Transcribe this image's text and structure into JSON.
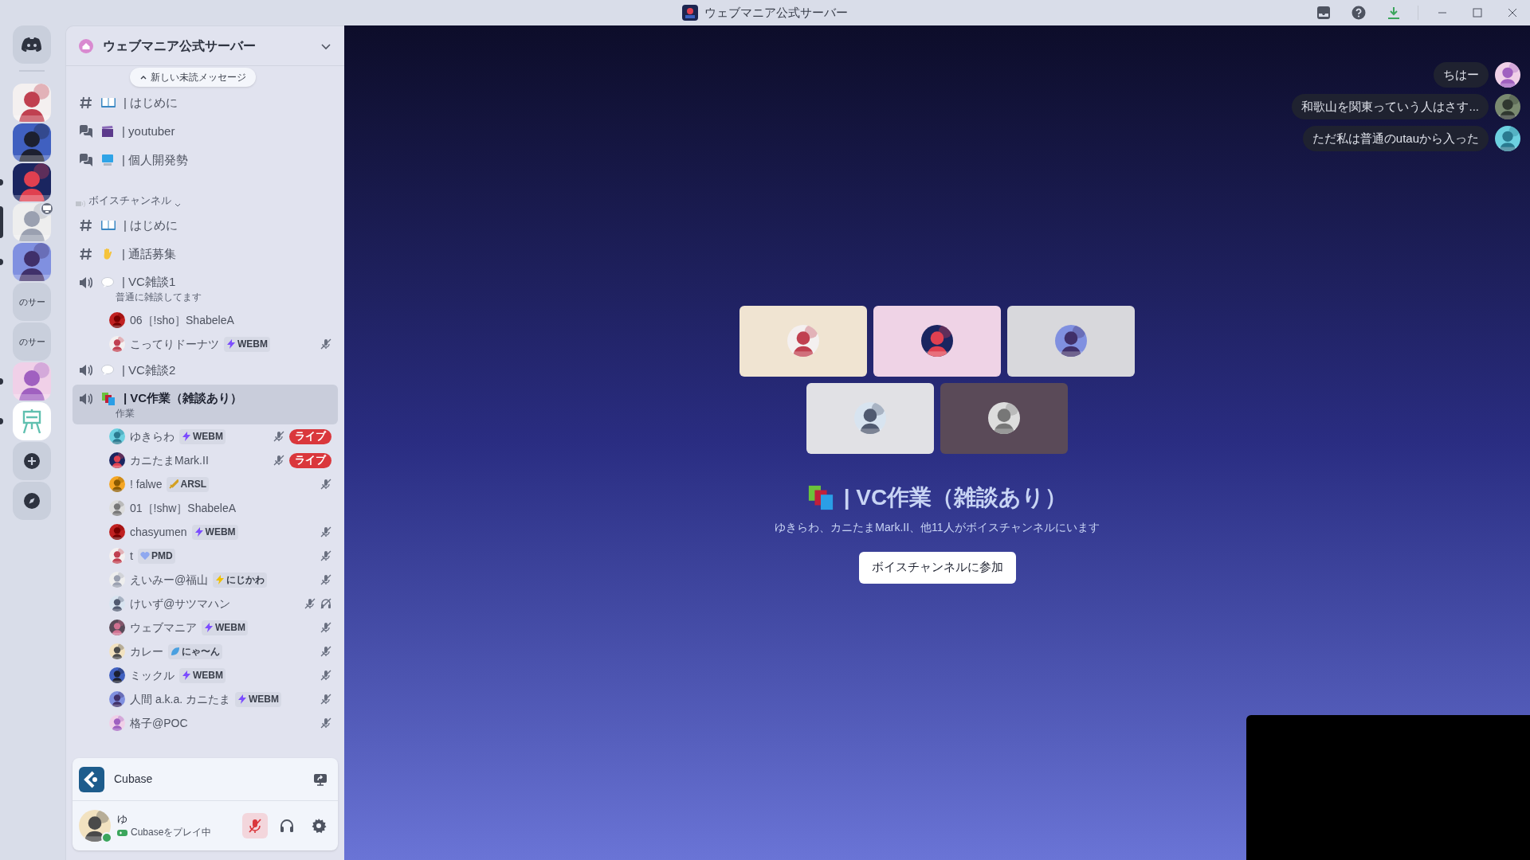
{
  "window": {
    "title": "ウェブマニア公式サーバー"
  },
  "servers": [
    {
      "kind": "home",
      "selected": false,
      "unread": false
    },
    {
      "kind": "picture",
      "selected": false,
      "unread": false
    },
    {
      "kind": "picture",
      "selected": false,
      "unread": false
    },
    {
      "kind": "picture",
      "selected": false,
      "unread": true
    },
    {
      "kind": "picture",
      "selected": true,
      "unread": false,
      "streaming": true
    },
    {
      "kind": "picture",
      "selected": false,
      "unread": true
    },
    {
      "kind": "label",
      "label": "のサー",
      "selected": false,
      "unread": false
    },
    {
      "kind": "label",
      "label": "のサー",
      "selected": false,
      "unread": false
    },
    {
      "kind": "picture",
      "selected": false,
      "unread": true
    },
    {
      "kind": "easel",
      "selected": false,
      "unread": true
    },
    {
      "kind": "add",
      "selected": false,
      "unread": false
    },
    {
      "kind": "explore",
      "selected": false,
      "unread": false
    }
  ],
  "sidebar": {
    "server_name": "ウェブマニア公式サーバー",
    "new_messages": "新しい未読メッセージ",
    "items": [
      {
        "kind": "text",
        "emoji": {
          "kind": "book"
        },
        "name": "| はじめに",
        "selected": false
      },
      {
        "kind": "forum",
        "emoji": {
          "kind": "clapper"
        },
        "name": "| youtuber",
        "selected": false
      },
      {
        "kind": "forum",
        "emoji": {
          "kind": "monitor"
        },
        "name": "| 個人開発勢",
        "selected": false
      },
      {
        "kind": "category",
        "name": "ボイスチャンネル"
      },
      {
        "kind": "text",
        "emoji": {
          "kind": "book"
        },
        "name": "| はじめに",
        "selected": false
      },
      {
        "kind": "text",
        "emoji": {
          "kind": "hand"
        },
        "name": "| 通話募集",
        "selected": false
      },
      {
        "kind": "voice",
        "emoji": {
          "kind": "bubble"
        },
        "name": "| VC雑談1",
        "topic": "普通に雑談してます",
        "selected": false,
        "members": [
          {
            "name": "06［!sho］ShabeleA",
            "muted": false,
            "deafened": false,
            "live": false
          },
          {
            "name": "こってりドーナツ",
            "tag": {
              "kind": "bolt",
              "color": "#7c4dff",
              "label": "WEBM"
            },
            "muted": true,
            "deafened": false,
            "live": false
          }
        ]
      },
      {
        "kind": "voice",
        "emoji": {
          "kind": "bubble"
        },
        "name": "| VC雑談2",
        "selected": false
      },
      {
        "kind": "voice",
        "emoji": {
          "kind": "books"
        },
        "name": "| VC作業（雑談あり）",
        "topic": "作業",
        "selected": true,
        "members": [
          {
            "name": "ゆきらわ",
            "tag": {
              "kind": "bolt",
              "color": "#7c4dff",
              "label": "WEBM"
            },
            "muted": true,
            "deafened": false,
            "live": true,
            "live_label": "ライブ"
          },
          {
            "name": "カニたまMark.II",
            "muted": true,
            "deafened": false,
            "live": true,
            "live_label": "ライブ"
          },
          {
            "name": "! falwe",
            "tag": {
              "kind": "sword",
              "color": "#d4a020",
              "label": "ARSL"
            },
            "muted": true,
            "deafened": false,
            "live": false
          },
          {
            "name": "01［!shw］ShabeleA",
            "muted": false,
            "deafened": false,
            "live": false
          },
          {
            "name": "chasyumen",
            "tag": {
              "kind": "bolt",
              "color": "#7c4dff",
              "label": "WEBM"
            },
            "muted": true,
            "deafened": false,
            "live": false
          },
          {
            "name": "t",
            "tag": {
              "kind": "heart",
              "color": "#8fa8f0",
              "label": "PMD"
            },
            "muted": true,
            "deafened": false,
            "live": false
          },
          {
            "name": "えいみー@福山",
            "tag": {
              "kind": "bolt",
              "color": "#f0c000",
              "label": "にじかわ"
            },
            "muted": true,
            "deafened": false,
            "live": false
          },
          {
            "name": "けいず@サツマハン",
            "muted": true,
            "deafened": true,
            "live": false
          },
          {
            "name": "ウェブマニア",
            "tag": {
              "kind": "bolt",
              "color": "#7c4dff",
              "label": "WEBM"
            },
            "muted": true,
            "deafened": false,
            "live": false
          },
          {
            "name": "カレー",
            "tag": {
              "kind": "leaf",
              "color": "#4aa0e0",
              "label": "にゃ〜ん"
            },
            "muted": true,
            "deafened": false,
            "live": false
          },
          {
            "name": "ミックル",
            "tag": {
              "kind": "bolt",
              "color": "#7c4dff",
              "label": "WEBM"
            },
            "muted": true,
            "deafened": false,
            "live": false
          },
          {
            "name": "人間 a.k.a. カニたま",
            "tag": {
              "kind": "bolt",
              "color": "#7c4dff",
              "label": "WEBM"
            },
            "muted": true,
            "deafened": false,
            "live": false
          },
          {
            "name": "格子@POC",
            "muted": true,
            "deafened": false,
            "live": false
          }
        ]
      }
    ]
  },
  "activity": {
    "app": "Cubase"
  },
  "user": {
    "name": "ゆ",
    "status": "Cubaseをプレイ中",
    "online": true,
    "mic_muted": true,
    "deafened": false
  },
  "chat_bubbles": [
    {
      "text": "ちはー"
    },
    {
      "text": "和歌山を関東っていう人はさす..."
    },
    {
      "text": "ただ私は普通のutauから入った"
    }
  ],
  "stage": {
    "tiles": [
      {
        "color": "#f0e4d2"
      },
      {
        "color": "#efd3e6"
      },
      {
        "color": "#d8d8dc"
      },
      {
        "color": "#e1e1e5"
      },
      {
        "color": "#5a4a58"
      }
    ],
    "emoji": {
      "kind": "books"
    },
    "title": "| VC作業（雑談あり）",
    "subtitle": "ゆきらわ、カニたまMark.II、他11人がボイスチャンネルにいます",
    "join_button": "ボイスチャンネルに参加"
  }
}
